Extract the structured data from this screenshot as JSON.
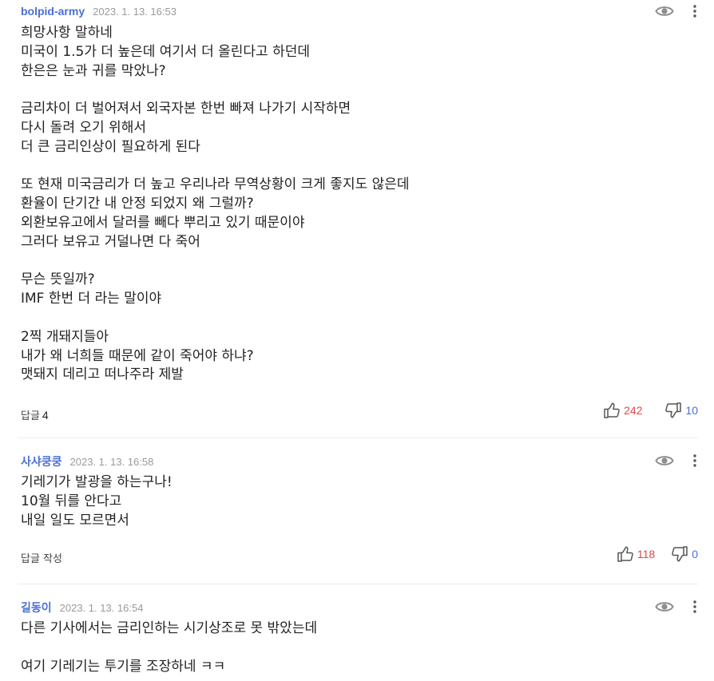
{
  "comments": [
    {
      "author": "bolpid-army",
      "date": "2023. 1. 13. 16:53",
      "lines": [
        "희망사항 말하네",
        "미국이 1.5가 더 높은데 여기서 더 올린다고 하던데",
        "한은은 눈과 귀를 막았나?",
        "",
        "금리차이 더 벌어져서 외국자본 한번 빠져 나가기 시작하면",
        "다시 돌려 오기 위해서",
        "더 큰 금리인상이 필요하게 된다",
        "",
        "또 현재 미국금리가 더 높고 우리나라 무역상황이 크게 좋지도 않은데",
        "환율이 단기간 내 안정 되었지 왜 그럴까?",
        "외환보유고에서 달러를 빼다 뿌리고 있기 때문이야",
        "그러다 보유고 거덜나면 다 죽어",
        "",
        "무슨 뜻일까?",
        "IMF 한번 더 라는 말이야",
        "",
        "2찍 개돼지들아",
        "내가 왜 너희들 때문에 같이 죽어야 하냐?",
        "맷돼지 데리고 떠나주라 제발"
      ],
      "reply_label": "답글",
      "reply_count": "4",
      "likes": "242",
      "dislikes": "10"
    },
    {
      "author": "사샤쿵쿵",
      "date": "2023. 1. 13. 16:58",
      "lines": [
        "기레기가 발광을 하는구나!",
        "10월 뒤를 안다고",
        "내일 일도 모르면서"
      ],
      "reply_label": "답글 작성",
      "likes": "118",
      "dislikes": "0"
    },
    {
      "author": "길동이",
      "date": "2023. 1. 13. 16:54",
      "lines": [
        "다른 기사에서는 금리인하는 시기상조로 못 밖았는데",
        "",
        "여기 기레기는 투기를 조장하네 ㅋㅋ"
      ]
    }
  ],
  "icons": {
    "view": "eye-icon",
    "more": "more-vertical-icon",
    "like": "thumbs-up-icon",
    "dislike": "thumbs-down-icon"
  },
  "colors": {
    "author": "#4a6fd5",
    "likes": "#e0474b",
    "dislikes": "#4a6fd5",
    "icon": "#8e8e8e"
  }
}
